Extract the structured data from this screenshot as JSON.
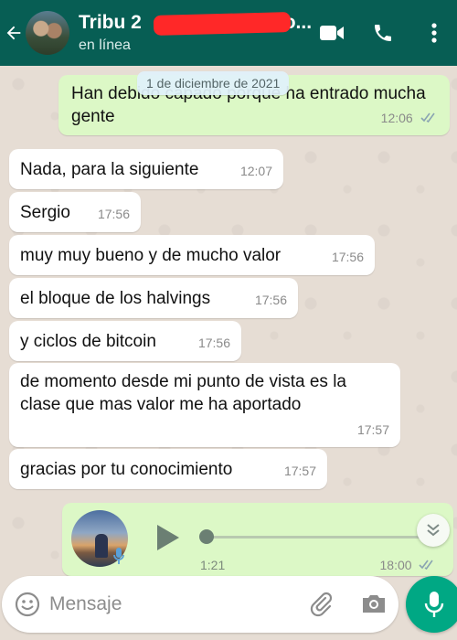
{
  "header": {
    "title": "Tribu 2",
    "title_tail": "o...",
    "status": "en línea",
    "icons": [
      "back-arrow-icon",
      "video-call-icon",
      "phone-icon",
      "more-vert-icon"
    ]
  },
  "date_chip": "1 de diciembre de 2021",
  "messages": [
    {
      "dir": "out",
      "text": "Han debido capado porque ha entrado mucha gente",
      "time": "12:06",
      "ticks": "read"
    },
    {
      "dir": "in",
      "text": "Nada, para la siguiente",
      "time": "12:07"
    },
    {
      "dir": "in",
      "text": "Sergio",
      "time": "17:56"
    },
    {
      "dir": "in",
      "text": "muy muy bueno y de mucho valor",
      "time": "17:56"
    },
    {
      "dir": "in",
      "text": "el bloque de los halvings",
      "time": "17:56"
    },
    {
      "dir": "in",
      "text": "y ciclos de bitcoin",
      "time": "17:56"
    },
    {
      "dir": "in",
      "text": "de momento desde mi punto de vista es la clase que mas valor me ha aportado",
      "time": "17:57"
    },
    {
      "dir": "in",
      "text": "gracias por tu conocimiento",
      "time": "17:57"
    }
  ],
  "voice_note": {
    "duration": "1:21",
    "time": "18:00",
    "progress": 0,
    "ticks": "read"
  },
  "composer": {
    "placeholder": "Mensaje"
  },
  "colors": {
    "header": "#075e54",
    "outgoing": "#dcf8c6",
    "incoming": "#ffffff",
    "accent": "#00a884",
    "read_ticks": "#34b7f1",
    "redaction": "#ff2828"
  }
}
